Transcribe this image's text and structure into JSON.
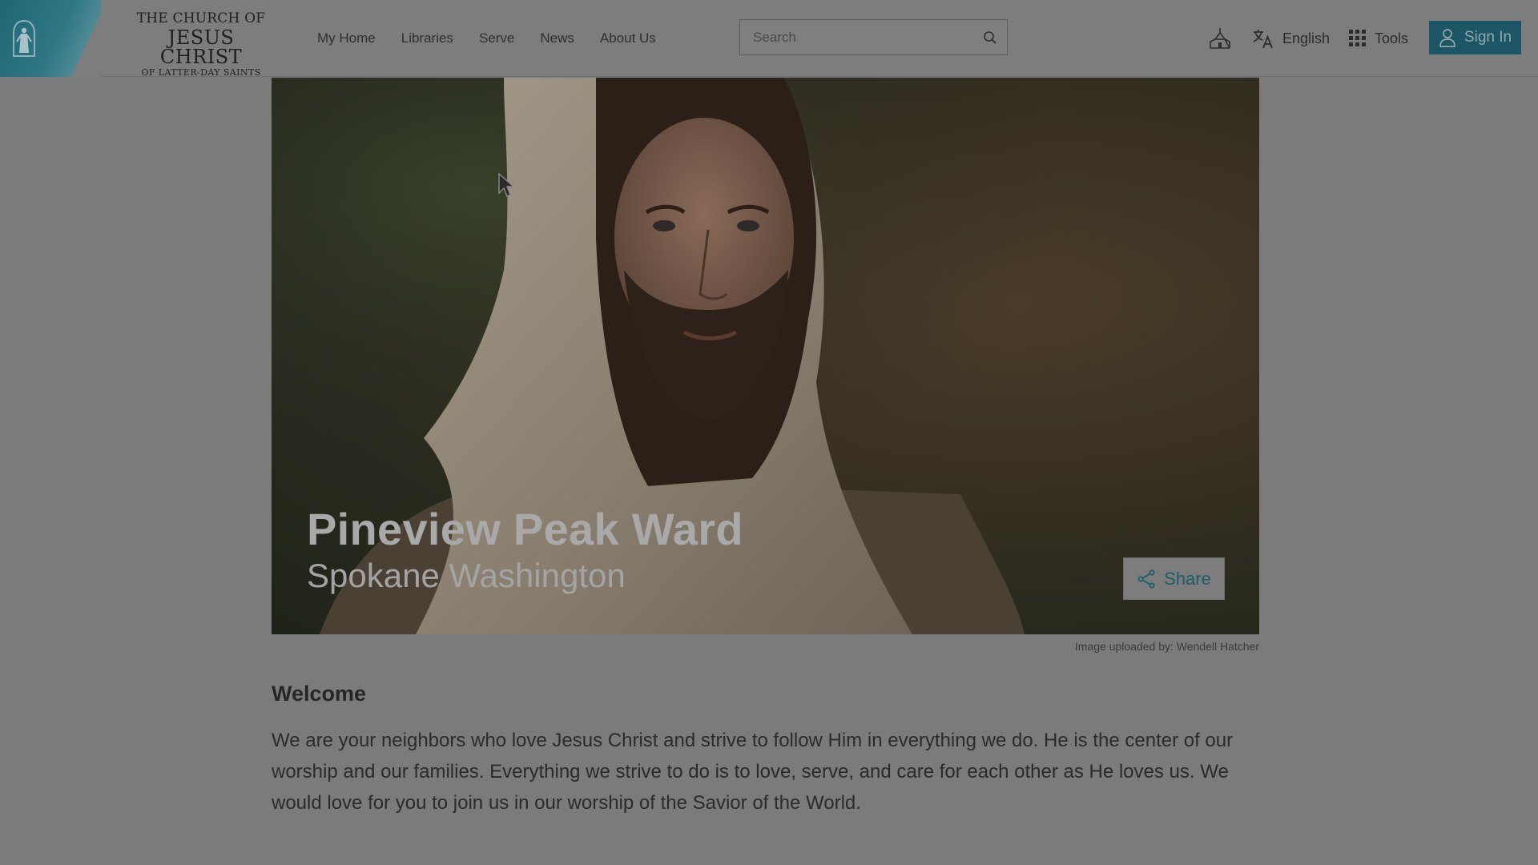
{
  "header": {
    "wordmark": {
      "line1": "THE CHURCH OF",
      "line2": "JESUS CHRIST",
      "line3": "OF LATTER-DAY SAINTS"
    },
    "nav": [
      {
        "label": "My Home"
      },
      {
        "label": "Libraries"
      },
      {
        "label": "Serve"
      },
      {
        "label": "News"
      },
      {
        "label": "About Us"
      }
    ],
    "search": {
      "placeholder": "Search",
      "icon": "search-icon"
    },
    "meetinghouse_icon": "meetinghouse-icon",
    "language": {
      "label": "English",
      "icon": "translate-icon"
    },
    "tools": {
      "label": "Tools",
      "icon": "grid-icon"
    },
    "signin": {
      "label": "Sign In",
      "icon": "user-icon"
    }
  },
  "hero": {
    "title": "Pineview Peak Ward",
    "subtitle": "Spokane Washington",
    "share_label": "Share",
    "credit": "Image uploaded by: Wendell Hatcher"
  },
  "welcome": {
    "heading": "Welcome",
    "body": "We are your neighbors who love Jesus Christ and strive to follow Him in everything we do. He is the center of our worship and our families. Everything we strive to do is to love, serve, and care for each other as He loves us. We would love for you to join us in our worship of the Savior of the World."
  },
  "colors": {
    "accent": "#1c5563",
    "overlay_bg": "#7b7b7b"
  }
}
